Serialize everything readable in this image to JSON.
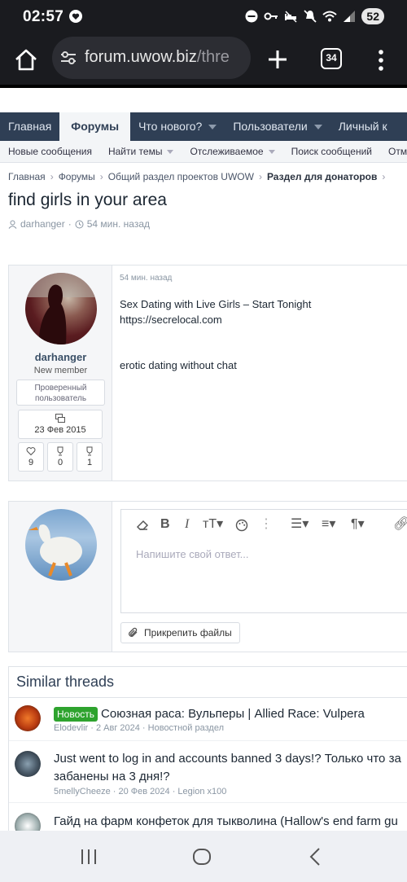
{
  "status": {
    "time": "02:57",
    "battery": "52"
  },
  "browser": {
    "url_host": "forum.uwow.biz",
    "url_path": "/thre",
    "tab_count": "34"
  },
  "nav": {
    "tabs": [
      "Главная",
      "Форумы",
      "Что нового?",
      "Пользователи",
      "Личный к"
    ],
    "active": "Форумы"
  },
  "subnav": [
    "Новые сообщения",
    "Найти темы",
    "Отслеживаемое",
    "Поиск сообщений",
    "Отметит"
  ],
  "breadcrumb": [
    "Главная",
    "Форумы",
    "Общий раздел проектов UWOW",
    "Раздел для донаторов"
  ],
  "thread": {
    "title": "find girls in your area",
    "author": "darhanger",
    "time": "54 мин. назад"
  },
  "post": {
    "username": "darhanger",
    "user_title": "New member",
    "banner": "Проверенный пользователь",
    "joined": "23 Фев 2015",
    "stats": {
      "likes": "9",
      "points": "0",
      "trophies": "1"
    },
    "date": "54 мин. назад",
    "line1": "Sex Dating with Live Girls – Start Tonight",
    "line2": "https://secrelocal.com",
    "line3": "erotic dating without chat"
  },
  "reply": {
    "placeholder": "Напишите свой ответ...",
    "attach_label": "Прикрепить файлы"
  },
  "similar": {
    "heading": "Similar threads",
    "items": [
      {
        "badge": "Новость",
        "title": "Союзная раса: Вульперы | Allied Race: Vulpera",
        "author": "Elodevlir",
        "date": "2 Авг 2024",
        "forum": "Новостной раздел"
      },
      {
        "title_line1": "Just went to log in and accounts banned 3 days!? Только что за",
        "title_line2": "забанены на 3 дня!?",
        "author": "5mellyCheeze",
        "date": "20 Фев 2024",
        "forum": "Legion x100"
      },
      {
        "title": "Гайд на фарм конфеток для тыкволина (Hallow's end farm gu"
      }
    ]
  }
}
